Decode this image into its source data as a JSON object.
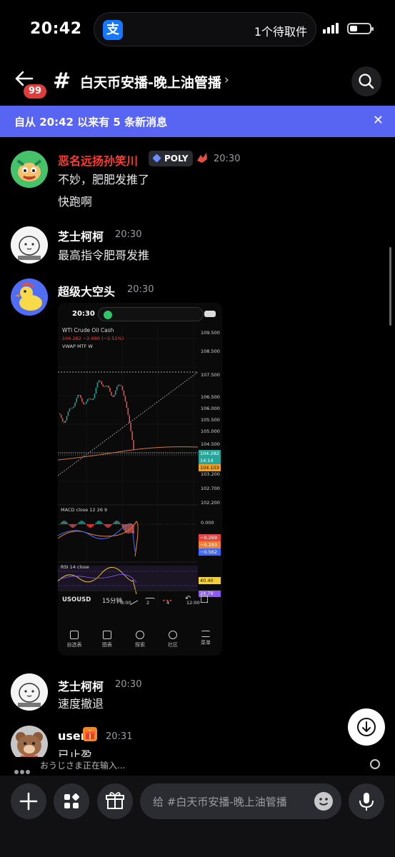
{
  "status_bar": {
    "time": "20:42",
    "island_text": "1个待取件",
    "alipay_glyph": "支"
  },
  "header": {
    "badge": "99",
    "hash": "#",
    "title": "白天币安播-晚上油管播",
    "chevron": "›"
  },
  "banner": {
    "text": "自从 20:42 以来有 5 条新消息",
    "close": "✕"
  },
  "messages": [
    {
      "name": "恶名远扬孙笑川",
      "name_color": "#ff3b30",
      "tag": "POLY",
      "time": "20:30",
      "lines": [
        "不妙，肥肥发推了",
        "快跑啊"
      ]
    },
    {
      "name": "芝士柯柯",
      "name_color": "#ffffff",
      "time": "20:30",
      "lines": [
        "最高指令肥哥发推"
      ]
    },
    {
      "name": "超级大空头",
      "name_color": "#ffffff",
      "time": "20:30",
      "lines": []
    },
    {
      "name": "芝士柯柯",
      "name_color": "#ffffff",
      "time": "20:30",
      "lines": [
        "速度撤退"
      ]
    },
    {
      "name": "user",
      "name_color": "#ffffff",
      "time": "20:31",
      "lines": [
        "已止盈"
      ]
    }
  ],
  "screenshot": {
    "time": "20:30",
    "symbol_title": "WTI Crude Oil Cash",
    "price_change": "104.282 −2.680 (−2.51%)",
    "vwap_label": "VWAP MTF W",
    "macd_label": "MACD close 12 26 9",
    "rsi_label": "RSI 14 close",
    "symbol": "USOUSD",
    "timeframe": "15分钟",
    "price_scale": [
      "109.500",
      "108.500",
      "107.500",
      "106.500",
      "106.000",
      "105.500",
      "105.000",
      "104.500",
      "103.200",
      "102.700",
      "102.200"
    ],
    "price_tags": [
      {
        "value": "104.282",
        "color": "#26a69a"
      },
      {
        "value": "14:14",
        "color": "#26a69a"
      },
      {
        "value": "104.103",
        "color": "#f0a020"
      }
    ],
    "macd_scale": [
      "0.000"
    ],
    "macd_tags": [
      {
        "value": "−0.269",
        "color": "#e84545"
      },
      {
        "value": "−0.293",
        "color": "#f07f2f"
      },
      {
        "value": "−0.562",
        "color": "#3d6bff"
      }
    ],
    "rsi_tags": [
      {
        "value": "40.40",
        "color": "#f2d038"
      },
      {
        "value": "24.79",
        "color": "#8a5cf5"
      }
    ],
    "time_axis": [
      "8:00",
      "2",
      "4",
      "12:00"
    ],
    "tabs": [
      "自选表",
      "图表",
      "探索",
      "社区",
      "菜单"
    ]
  },
  "typing": "おうじさま正在输入...",
  "composer": {
    "placeholder": "给 #白天币安播-晚上油管播"
  },
  "colors": {
    "accent": "#5865f2",
    "badge": "#e03c3c",
    "background": "#000000"
  }
}
